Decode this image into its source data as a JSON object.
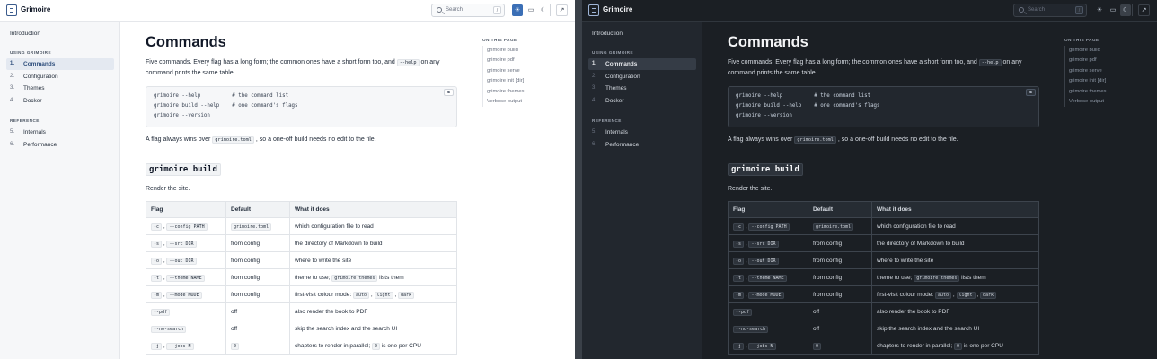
{
  "brand": "Grimoire",
  "search": {
    "placeholder": "Search",
    "shortcut": "/"
  },
  "icons": {
    "logo": "book-icon",
    "search": "search-icon",
    "light": "sun-icon",
    "system": "monitor-icon",
    "dark": "moon-icon",
    "external": "external-link-icon",
    "copy": "copy-icon"
  },
  "colors": {
    "accent": "#3b6fb6",
    "dark_bg": "#1b1f24",
    "light_bg": "#ffffff"
  },
  "sidebar": {
    "intro": "Introduction",
    "sections": [
      {
        "title": "USING GRIMOIRE",
        "items": [
          {
            "num": "1.",
            "label": "Commands"
          },
          {
            "num": "2.",
            "label": "Configuration"
          },
          {
            "num": "3.",
            "label": "Themes"
          },
          {
            "num": "4.",
            "label": "Docker"
          }
        ]
      },
      {
        "title": "REFERENCE",
        "items": [
          {
            "num": "5.",
            "label": "Internals"
          },
          {
            "num": "6.",
            "label": "Performance"
          }
        ]
      }
    ]
  },
  "page": {
    "title": "Commands",
    "intro_a": "Five commands. Every flag has a long form; the common ones have a short form too, and",
    "intro_code": "--help",
    "intro_b": "on any command prints the same table.",
    "code_lines": [
      "grimoire --help          # the command list",
      "grimoire build --help    # one command's flags",
      "grimoire --version"
    ],
    "copy_label": "⧉",
    "flag_note_a": "A flag always wins over",
    "flag_note_code": "grimoire.toml",
    "flag_note_b": ", so a one-off build needs no edit to the file.",
    "section_title": "grimoire build",
    "section_desc": "Render the site.",
    "table_headers": [
      "Flag",
      "Default",
      "What it does"
    ],
    "rows": [
      {
        "short": "-c",
        "long": "--config PATH",
        "default": "grimoire.toml",
        "default_code": true,
        "desc": "which configuration file to read"
      },
      {
        "short": "-s",
        "long": "--src DIR",
        "default": "from config",
        "default_code": false,
        "desc": "the directory of Markdown to build"
      },
      {
        "short": "-o",
        "long": "--out DIR",
        "default": "from config",
        "default_code": false,
        "desc": "where to write the site"
      },
      {
        "short": "-t",
        "long": "--theme NAME",
        "default": "from config",
        "default_code": false,
        "desc": "theme to use;",
        "desc_code": "grimoire themes",
        "desc_tail": "lists them"
      },
      {
        "short": "-m",
        "long": "--mode MODE",
        "default": "from config",
        "default_code": false,
        "desc": "first-visit colour mode:",
        "desc_codes": [
          "auto",
          "light",
          "dark"
        ]
      },
      {
        "short": "",
        "long": "--pdf",
        "default": "off",
        "default_code": false,
        "desc": "also render the book to PDF"
      },
      {
        "short": "",
        "long": "--no-search",
        "default": "off",
        "default_code": false,
        "desc": "skip the search index and the search UI"
      },
      {
        "short": "-j",
        "long": "--jobs N",
        "default": "0",
        "default_code": true,
        "desc": "chapters to render in parallel;",
        "desc_code": "0",
        "desc_tail": "is one per CPU"
      }
    ]
  },
  "toc": {
    "heading": "ON THIS PAGE",
    "items": [
      "grimoire build",
      "grimoire pdf",
      "grimoire serve",
      "grimoire init [dir]",
      "grimoire themes",
      "Verbose output"
    ]
  }
}
